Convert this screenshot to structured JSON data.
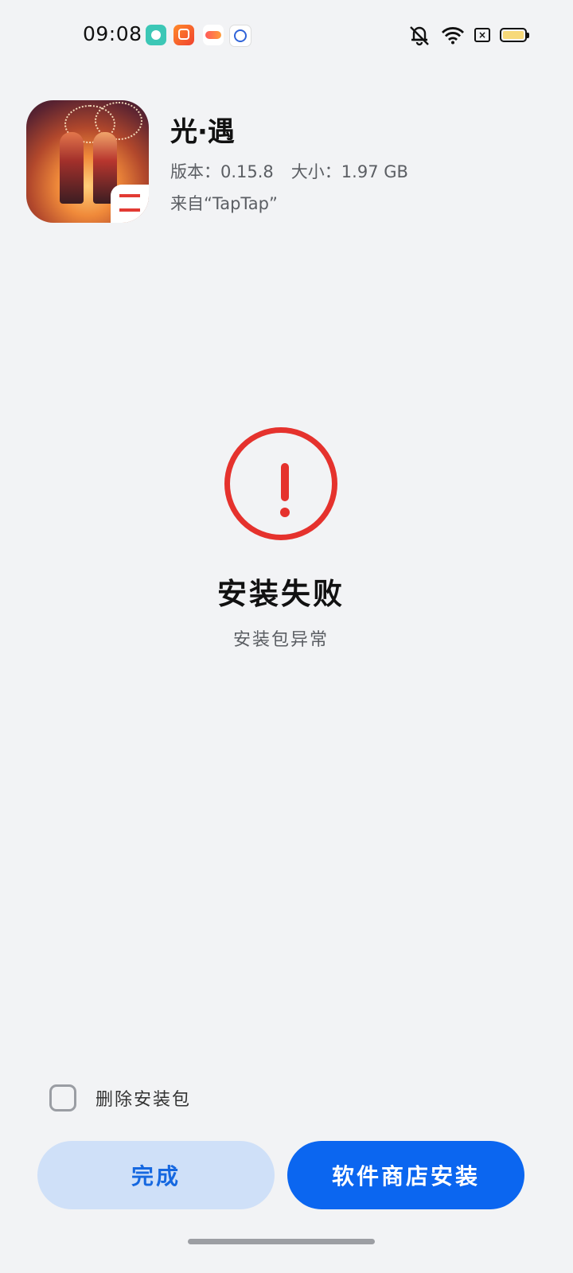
{
  "status_bar": {
    "time": "09:08",
    "notification_icons": [
      "chat-app-icon",
      "kuaishou-app-icon",
      "game-center-icon",
      "baidu-app-icon"
    ],
    "right_icons": [
      "mute-bell-icon",
      "wifi-icon",
      "no-sim-icon",
      "battery-icon"
    ],
    "battery_color": "#f7d97a"
  },
  "app": {
    "name": "光·遇",
    "version_label": "版本：0.15.8",
    "size_label": "大小：1.97 GB",
    "source_label": "来自“TapTap”"
  },
  "result": {
    "title": "安装失败",
    "subtitle": "安装包异常",
    "color": "#e5322d"
  },
  "options": {
    "delete_package_label": "删除安装包",
    "delete_package_checked": false
  },
  "buttons": {
    "done_label": "完成",
    "store_install_label": "软件商店安装",
    "accent": "#0b66f0"
  }
}
